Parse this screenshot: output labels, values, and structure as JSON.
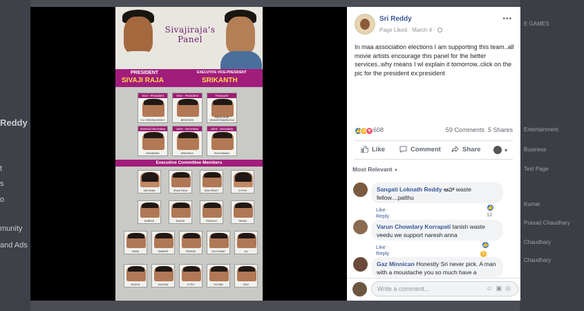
{
  "background": {
    "left_fragments": [
      "Reddy",
      "t",
      "s",
      "o",
      "munity",
      "and Ads"
    ],
    "right_fragments": [
      "E GAMES",
      "Entertainment",
      "Business",
      "Test Page",
      "Kumar",
      "Prasad Chaudhary",
      "Chaudhary",
      "Chaudhary"
    ]
  },
  "poster": {
    "title": "Sivajiraja's Panel",
    "left_role": "PRESIDENT",
    "left_name": "SIVAJI RAJA",
    "right_role": "EXECUTIVE VICE-PRESIDENT",
    "right_name": "SRIKANTH",
    "office_bearers": [
      {
        "role": "Vice - President",
        "name": "S.V. KRISHNA REDDY"
      },
      {
        "role": "Vice - President",
        "name": "BENERJEE"
      },
      {
        "role": "Treasurer",
        "name": "PARUCHURI VENKATESWARA RAO"
      },
      {
        "role": "General Secretary",
        "name": "NAGABABU"
      },
      {
        "role": "Joint - Secretary",
        "name": "BRAHMAJI"
      },
      {
        "role": "Joint - Secretary",
        "name": "RAGHUBABU"
      }
    ],
    "committee_title": "Executive Committee Members",
    "members": [
      "ARCHANA",
      "SIVAJI RAJU",
      "SIVA REDDY",
      "JYOTHI",
      "SURESH",
      "RAGHU",
      "PRUDHVI",
      "TARUN",
      "RAMA",
      "SAMEER",
      "PRASAD",
      "SAI KUMAR",
      "ALI",
      "RAGHU",
      "GAUTAM",
      "UTTEJ",
      "GOVIND",
      "RAVI"
    ]
  },
  "post": {
    "author": "Sri Reddy",
    "meta": "Page Liked · March 4 ·",
    "more_icon": "more-icon",
    "text": "In maa association elections I am supporting this team..all movie artists encourage this panel for the better services..why means I wl explain it tomorrow..click on the pic for the president ex:president",
    "reaction_count": "608",
    "comments_count": "59 Comments",
    "shares_count": "5 Shares",
    "like_label": "Like",
    "comment_label": "Comment",
    "share_label": "Share",
    "sort_label": "Most Relevant"
  },
  "colors": {
    "link": "#385898",
    "like_blue": "#2078f4",
    "haha_yellow": "#f7b125",
    "love_red": "#f25268",
    "poster_magenta": "#a21d7b"
  },
  "comments": [
    {
      "author": "Sangati Loknath Reddy",
      "text": "ఆహా waste fellow....palthu",
      "like": "Like",
      "reply": "Reply",
      "time": "3d",
      "reactions": "12"
    },
    {
      "author": "Varun Chowdary Korrapati",
      "text": "tanish waste veedu we support naresh anna",
      "like": "Like",
      "reply": "Reply",
      "time": "2d",
      "reactions": "4"
    },
    {
      "author": "Gaz Minnican",
      "text": "Honestly Sri never pick. A man with a moustache you so much have a"
    }
  ],
  "write_comment": {
    "placeholder": "Write a comment..."
  }
}
